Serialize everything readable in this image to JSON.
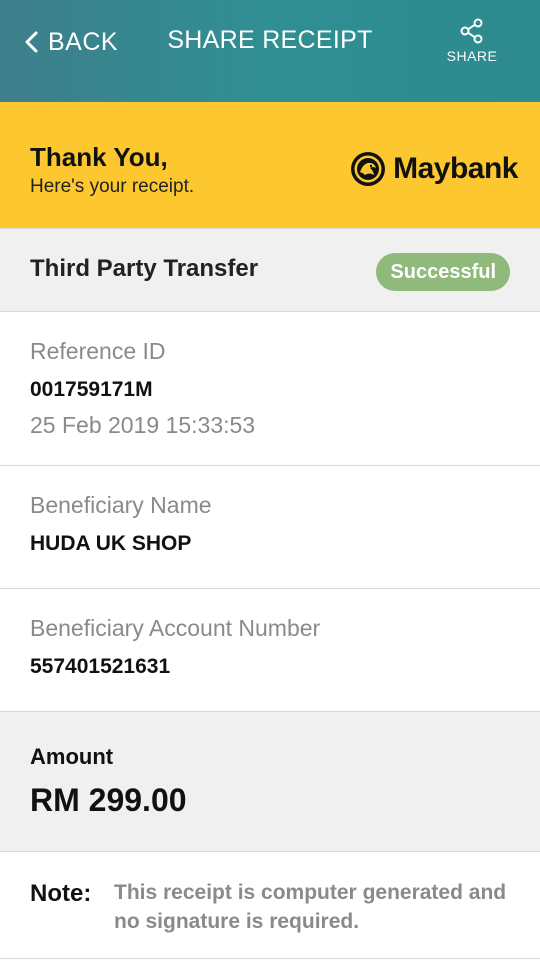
{
  "header": {
    "back_label": "BACK",
    "title": "SHARE RECEIPT",
    "share_label": "SHARE"
  },
  "banner": {
    "thanks": "Thank You,",
    "subtitle": "Here's your receipt.",
    "brand": "Maybank",
    "brand_color": "#fdc82f"
  },
  "transfer": {
    "type": "Third Party Transfer",
    "status": "Successful",
    "status_color": "#8fba7c"
  },
  "reference": {
    "label": "Reference ID",
    "id": "001759171M",
    "datetime": "25 Feb 2019 15:33:53"
  },
  "beneficiary": {
    "name_label": "Beneficiary Name",
    "name": "HUDA UK SHOP",
    "account_label": "Beneficiary Account Number",
    "account": "557401521631"
  },
  "amount": {
    "label": "Amount",
    "value": "RM 299.00"
  },
  "note": {
    "label": "Note:",
    "text": "This receipt is computer generated and no signature is required."
  },
  "icons": {
    "back": "chevron-left-icon",
    "share": "share-icon",
    "logo": "maybank-tiger-logo"
  }
}
